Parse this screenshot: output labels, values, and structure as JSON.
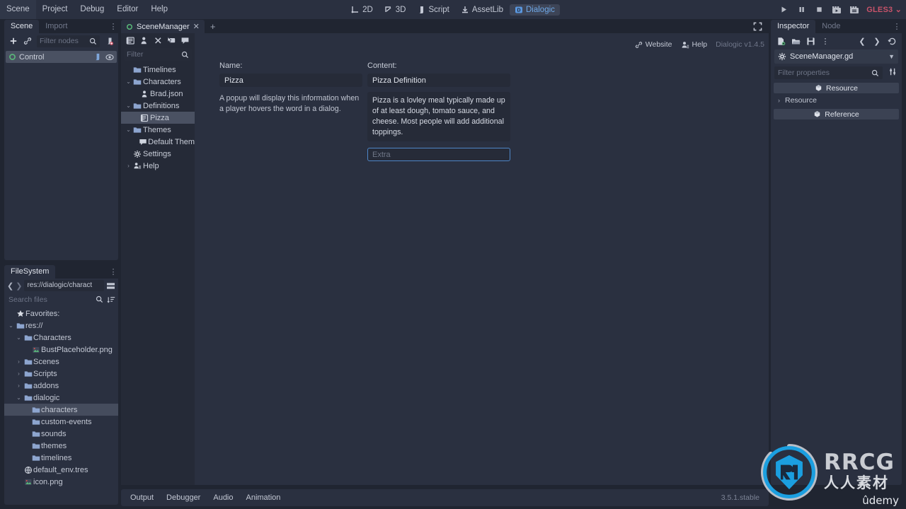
{
  "menu": {
    "items": [
      "Scene",
      "Project",
      "Debug",
      "Editor",
      "Help"
    ]
  },
  "mode_buttons": [
    {
      "label": "2D",
      "icon": "2d-icon",
      "active": false
    },
    {
      "label": "3D",
      "icon": "3d-icon",
      "active": false
    },
    {
      "label": "Script",
      "icon": "script-icon",
      "active": false
    },
    {
      "label": "AssetLib",
      "icon": "assetlib-icon",
      "active": false
    },
    {
      "label": "Dialogic",
      "icon": "dialogic-icon",
      "active": true
    }
  ],
  "playback": {
    "play": "play-icon",
    "pause": "pause-icon",
    "stop": "stop-icon",
    "play_scene": "play-scene-icon",
    "play_custom": "play-custom-scene-icon",
    "renderer": "GLES3",
    "renderer_color": "#c8536a"
  },
  "scene_dock": {
    "tabs": [
      {
        "label": "Scene",
        "active": true
      },
      {
        "label": "Import",
        "active": false
      }
    ],
    "toolbar": {
      "add_icon": "plus-icon",
      "link_icon": "instance-child-scene-icon",
      "search_icon": "search-icon",
      "script_icon": "attach-script-icon"
    },
    "filter_placeholder": "Filter nodes",
    "tree": [
      {
        "label": "Control",
        "icon": "control-node-icon",
        "selected": true,
        "script_icon": "script-icon",
        "visibility_icon": "eye-icon"
      }
    ]
  },
  "filesystem_dock": {
    "tab": "FileSystem",
    "path": "res://dialogic/charact",
    "path_toggle_icon": "split-mode-icon",
    "nav_back_icon": "chevron-left-icon",
    "nav_forward_icon": "chevron-right-icon",
    "search_placeholder": "Search files",
    "sort_icon": "sort-icon",
    "tree": [
      {
        "label": "Favorites:",
        "icon": "star-icon",
        "depth": 0,
        "arrow": "",
        "selected": false
      },
      {
        "label": "res://",
        "icon": "folder-icon",
        "depth": 0,
        "arrow": "open",
        "selected": false
      },
      {
        "label": "Characters",
        "icon": "folder-icon",
        "depth": 1,
        "arrow": "open",
        "selected": false
      },
      {
        "label": "BustPlaceholder.png",
        "icon": "image-file-icon",
        "depth": 2,
        "arrow": "",
        "selected": false
      },
      {
        "label": "Scenes",
        "icon": "folder-icon",
        "depth": 1,
        "arrow": "closed",
        "selected": false
      },
      {
        "label": "Scripts",
        "icon": "folder-icon",
        "depth": 1,
        "arrow": "closed",
        "selected": false
      },
      {
        "label": "addons",
        "icon": "folder-icon",
        "depth": 1,
        "arrow": "closed",
        "selected": false
      },
      {
        "label": "dialogic",
        "icon": "folder-icon",
        "depth": 1,
        "arrow": "open",
        "selected": false
      },
      {
        "label": "characters",
        "icon": "folder-icon",
        "depth": 2,
        "arrow": "",
        "selected": true
      },
      {
        "label": "custom-events",
        "icon": "folder-icon",
        "depth": 2,
        "arrow": "",
        "selected": false
      },
      {
        "label": "sounds",
        "icon": "folder-icon",
        "depth": 2,
        "arrow": "",
        "selected": false
      },
      {
        "label": "themes",
        "icon": "folder-icon",
        "depth": 2,
        "arrow": "",
        "selected": false
      },
      {
        "label": "timelines",
        "icon": "folder-icon",
        "depth": 2,
        "arrow": "",
        "selected": false
      },
      {
        "label": "default_env.tres",
        "icon": "environment-resource-icon",
        "depth": 1,
        "arrow": "",
        "selected": false
      },
      {
        "label": "icon.png",
        "icon": "image-file-icon",
        "depth": 1,
        "arrow": "",
        "selected": false
      }
    ]
  },
  "scene_tabs": {
    "tabs": [
      {
        "label": "SceneManager",
        "icon": "control-node-icon",
        "close_icon": "close-icon",
        "active": true
      }
    ],
    "add_tab_icon": "plus-icon",
    "expand_icon": "distraction-free-icon"
  },
  "dialogic": {
    "toolbar": [
      {
        "icon": "new-timeline-icon",
        "name": "new-timeline"
      },
      {
        "icon": "new-character-icon",
        "name": "new-character"
      },
      {
        "icon": "new-definition-icon",
        "name": "new-definition"
      },
      {
        "icon": "new-glossary-icon",
        "name": "new-glossary"
      },
      {
        "icon": "new-theme-icon",
        "name": "new-theme"
      }
    ],
    "filter_placeholder": "Filter",
    "tree": [
      {
        "label": "Timelines",
        "icon": "folder-icon",
        "depth": 0,
        "arrow": "",
        "selected": false
      },
      {
        "label": "Characters",
        "icon": "folder-icon",
        "depth": 0,
        "arrow": "open",
        "selected": false
      },
      {
        "label": "Brad.json",
        "icon": "character-icon",
        "depth": 1,
        "arrow": "",
        "selected": false
      },
      {
        "label": "Definitions",
        "icon": "folder-icon",
        "depth": 0,
        "arrow": "open",
        "selected": false
      },
      {
        "label": "Pizza",
        "icon": "definition-icon",
        "depth": 1,
        "arrow": "",
        "selected": true
      },
      {
        "label": "Themes",
        "icon": "folder-icon",
        "depth": 0,
        "arrow": "open",
        "selected": false
      },
      {
        "label": "Default Them",
        "icon": "theme-icon",
        "depth": 1,
        "arrow": "",
        "selected": false
      },
      {
        "label": "Settings",
        "icon": "gear-icon",
        "depth": 0,
        "arrow": "",
        "selected": false
      },
      {
        "label": "Help",
        "icon": "help-icon",
        "depth": 0,
        "arrow": "closed",
        "selected": false
      }
    ],
    "top_links": {
      "website": "Website",
      "website_icon": "link-icon",
      "help": "Help",
      "help_icon": "help-icon",
      "version": "Dialogic v1.4.5"
    },
    "editor": {
      "name_label": "Name:",
      "name_value": "Pizza",
      "name_hint": "A popup will display this information when a player hovers the word in a dialog.",
      "content_label": "Content:",
      "content_title_value": "Pizza Definition",
      "content_body_value": "Pizza is a lovley meal typically made up of at least dough, tomato sauce, and cheese. Most people will add additional toppings.",
      "extra_placeholder": "Extra",
      "extra_focus_color": "#4e86c7"
    }
  },
  "inspector": {
    "tabs": [
      {
        "label": "Inspector",
        "active": true
      },
      {
        "label": "Node",
        "active": false
      }
    ],
    "toolbar": {
      "new_resource_icon": "new-resource-icon",
      "load_icon": "folder-open-icon",
      "save_icon": "save-icon",
      "more_icon": "vertical-dots-icon",
      "back_icon": "chevron-left-icon",
      "forward_icon": "chevron-right-icon",
      "history_icon": "history-icon"
    },
    "resource": {
      "icon": "gear-icon",
      "name": "SceneManager.gd",
      "dropdown_icon": "chevron-down-icon",
      "docs_icon": "open-documentation-icon"
    },
    "filter_placeholder": "Filter properties",
    "filter_search_icon": "search-icon",
    "object_menu_icon": "object-options-icon",
    "properties": [
      {
        "kind": "category",
        "label": "Resource",
        "icon": "resource-icon"
      },
      {
        "kind": "group",
        "label": "Resource",
        "arrow": "closed"
      },
      {
        "kind": "category",
        "label": "Reference",
        "icon": "resource-icon"
      }
    ]
  },
  "bottom_panel": {
    "tabs": [
      "Output",
      "Debugger",
      "Audio",
      "Animation"
    ],
    "version": "3.5.1.stable"
  },
  "watermark": {
    "brand": "RRCG",
    "chinese": "人人素材",
    "udemy": "ûdemy"
  },
  "colors": {
    "background": "#202531",
    "panel": "#2a3040",
    "field": "#262b38",
    "selection": "#4a5162",
    "accent_blue": "#6ea8e8",
    "folder_blue": "#8da5cf",
    "renderer_red": "#c8536a"
  }
}
